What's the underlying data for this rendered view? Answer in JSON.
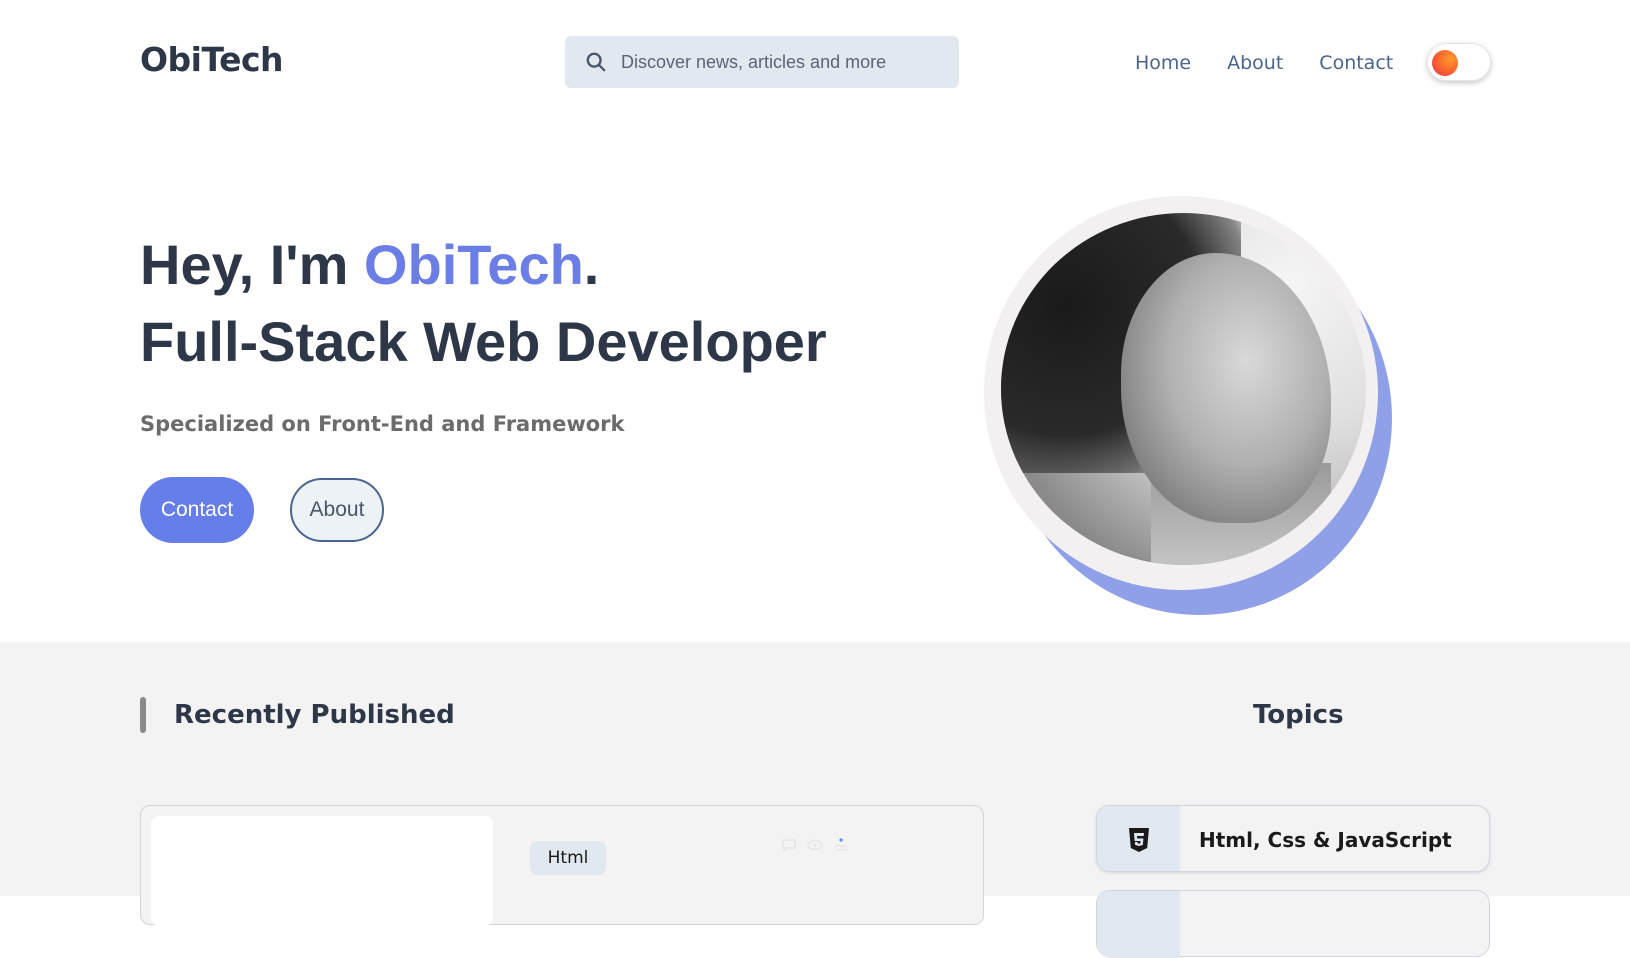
{
  "header": {
    "logo": "ObiTech",
    "search": {
      "placeholder": "Discover news, articles and more",
      "icon": "search-icon"
    },
    "nav": [
      {
        "label": "Home"
      },
      {
        "label": "About"
      },
      {
        "label": "Contact"
      }
    ],
    "theme_toggle": {
      "state": "light",
      "icon": "sun-icon"
    }
  },
  "hero": {
    "title_prefix": "Hey, I'm ",
    "title_name": "ObiTech",
    "title_suffix": ".",
    "title_line2": "Full-Stack Web Developer",
    "subtitle": "Specialized on Front-End and Framework",
    "contact_button": "Contact",
    "about_button": "About",
    "accent_color": "#667eea"
  },
  "recent": {
    "title": "Recently Published",
    "posts": [
      {
        "tag": "Html",
        "meta_icons": [
          "comment-icon",
          "eye-icon",
          "list-icon"
        ]
      }
    ]
  },
  "topics": {
    "title": "Topics",
    "items": [
      {
        "label": "Html, Css & JavaScript",
        "icon": "html5-icon"
      }
    ]
  }
}
